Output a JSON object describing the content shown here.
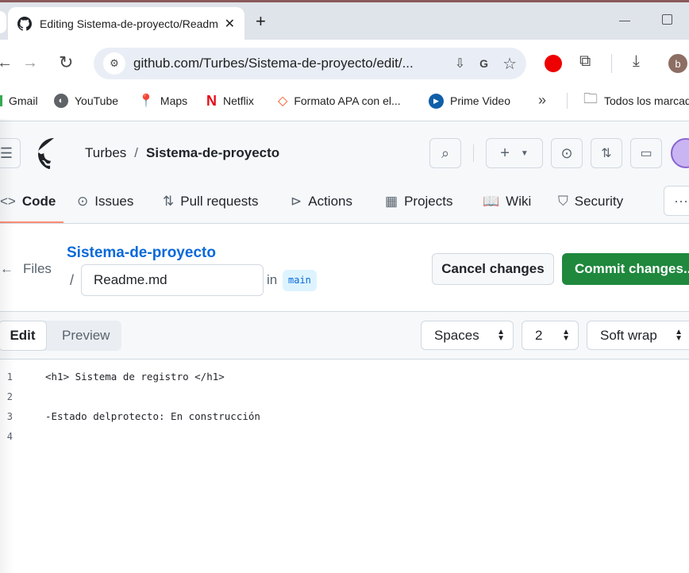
{
  "browser": {
    "tab_title": "Editing Sistema-de-proyecto/Readme.md",
    "url": "github.com/Turbes/Sistema-de-proyecto/edit/...",
    "profile_initial": "b",
    "bookmarks": [
      {
        "label": "Gmail",
        "icon": "gmail-icon"
      },
      {
        "label": "YouTube",
        "icon": "globe-icon"
      },
      {
        "label": "Maps",
        "icon": "maps-pin-icon"
      },
      {
        "label": "Netflix",
        "icon": "netflix-icon"
      },
      {
        "label": "Formato APA con el...",
        "icon": "apa-icon"
      },
      {
        "label": "Prime Video",
        "icon": "prime-video-icon"
      }
    ],
    "all_bookmarks": "Todos los marcadores"
  },
  "github": {
    "owner": "Turbes",
    "separator": "/",
    "repo": "Sistema-de-proyecto",
    "nav": [
      {
        "label": "Code",
        "icon": "code-icon"
      },
      {
        "label": "Issues",
        "icon": "issue-icon"
      },
      {
        "label": "Pull requests",
        "icon": "pull-request-icon"
      },
      {
        "label": "Actions",
        "icon": "play-icon"
      },
      {
        "label": "Projects",
        "icon": "table-icon"
      },
      {
        "label": "Wiki",
        "icon": "book-icon"
      },
      {
        "label": "Security",
        "icon": "shield-icon"
      }
    ],
    "accent": "#fd8c73"
  },
  "editor": {
    "files_label": "Files",
    "repo_link": "Sistema-de-proyecto",
    "filename": "Readme.md",
    "in_label": "in",
    "branch": "main",
    "cancel_label": "Cancel changes",
    "commit_label": "Commit changes...",
    "commit_color": "#1f883d",
    "edit_tab": "Edit",
    "preview_tab": "Preview",
    "indent_mode": "Spaces",
    "indent_size": "2",
    "wrap_mode": "Soft wrap",
    "lines": [
      {
        "n": "1",
        "text": "<h1> Sistema de registro </h1>"
      },
      {
        "n": "2",
        "text": ""
      },
      {
        "n": "3",
        "text": "-Estado delprotecto: En construcción"
      },
      {
        "n": "4",
        "text": ""
      }
    ]
  }
}
